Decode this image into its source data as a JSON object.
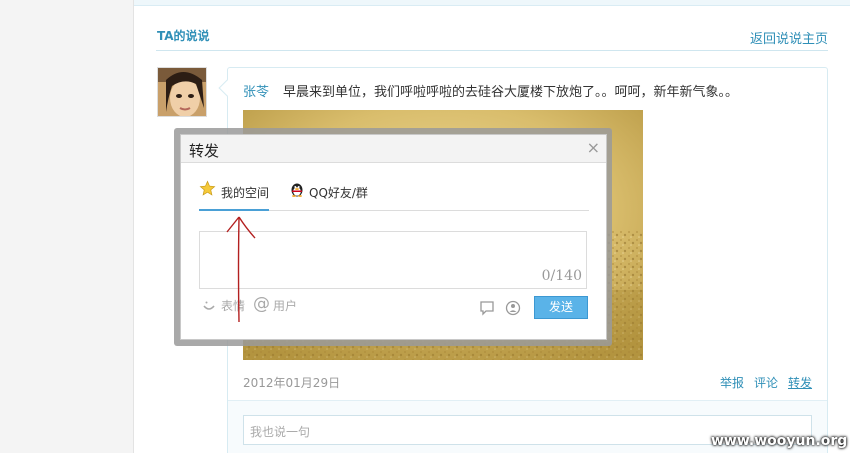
{
  "section": {
    "title": "TA的说说",
    "back_link": "返回说说主页"
  },
  "post": {
    "author": "张苓",
    "text": "早晨来到单位，我们呼啦呼啦的去硅谷大厦楼下放炮了。。呵呵，新年新气象。。",
    "date": "2012年01月29日",
    "actions": {
      "report": "举报",
      "comment": "评论",
      "forward": "转发"
    }
  },
  "reply": {
    "placeholder": "我也说一句"
  },
  "dialog": {
    "title": "转发",
    "close": "×",
    "tabs": [
      {
        "label": "我的空间",
        "icon": "star-icon",
        "active": true
      },
      {
        "label": "QQ好友/群",
        "icon": "qq-penguin-icon",
        "active": false
      }
    ],
    "counter": "0/140",
    "tools": {
      "emoji": "表情",
      "mention": "用户"
    },
    "send": "发送"
  },
  "watermark": "www.wooyun.org",
  "colors": {
    "link": "#2f8fb7",
    "send_button": "#5ab3e8",
    "annotation": "#b32020"
  }
}
